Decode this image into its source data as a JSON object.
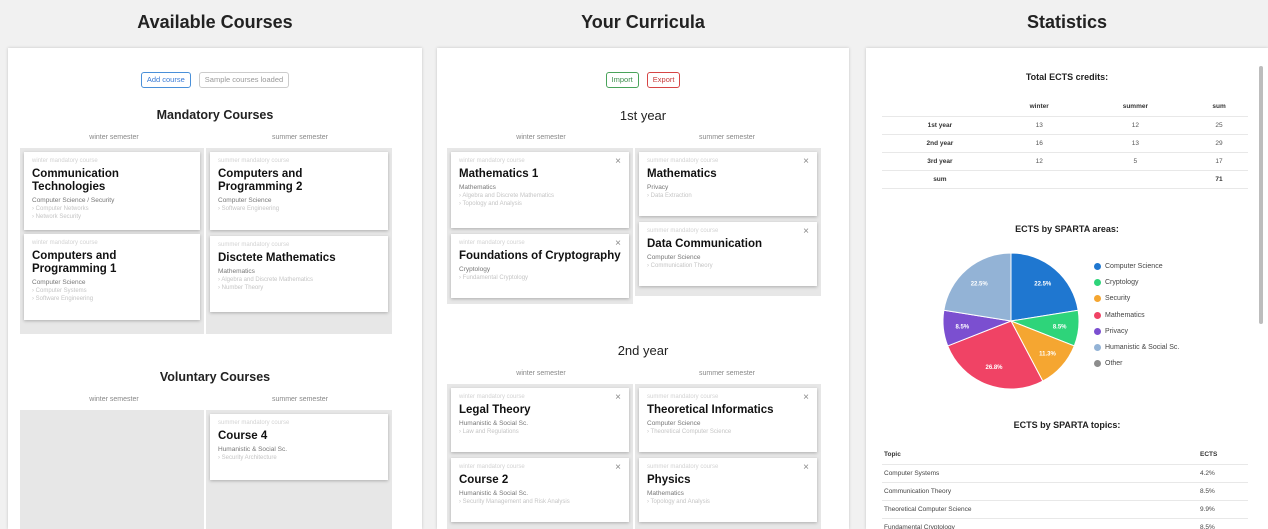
{
  "columns": {
    "available": "Available Courses",
    "curricula": "Your Curricula",
    "statistics": "Statistics"
  },
  "available": {
    "add_course": "Add course",
    "sample_loaded": "Sample courses loaded",
    "mandatory_title": "Mandatory Courses",
    "voluntary_title": "Voluntary Courses",
    "winter": "winter semester",
    "summer": "summer semester",
    "cards": [
      {
        "kind": "winter mandatory course",
        "name": "Communication Technologies",
        "area": "Computer Science / Security",
        "topics": [
          "› Computer Networks",
          "› Network Security"
        ]
      },
      {
        "kind": "winter mandatory course",
        "name": "Computers and Programming 1",
        "area": "Computer Science",
        "topics": [
          "› Computer Systems",
          "› Software Engineering"
        ]
      },
      {
        "kind": "summer mandatory course",
        "name": "Computers and Programming 2",
        "area": "Computer Science",
        "topics": [
          "› Software Engineering"
        ]
      },
      {
        "kind": "summer mandatory course",
        "name": "Disctete Mathematics",
        "area": "Mathematics",
        "topics": [
          "› Algebra and Discrete Mathematics",
          "› Number Theory"
        ]
      },
      {
        "kind": "summer mandatory course",
        "name": "Course 4",
        "area": "Humanistic & Social Sc.",
        "topics": [
          "› Security Architecture"
        ]
      }
    ]
  },
  "curricula": {
    "import": "Import",
    "export": "Export",
    "year1": "1st year",
    "year2": "2nd year",
    "winter": "winter semester",
    "summer": "summer semester",
    "close": "×",
    "cards": [
      {
        "kind": "winter mandatory course",
        "name": "Mathematics 1",
        "area": "Mathematics",
        "topics": [
          "› Algebra and Discrete Mathematics",
          "› Topology and Analysis"
        ]
      },
      {
        "kind": "winter mandatory course",
        "name": "Foundations of Cryptography",
        "area": "Cryptology",
        "topics": [
          "› Fundamental Cryptology"
        ]
      },
      {
        "kind": "summer mandatory course",
        "name": "Mathematics",
        "area": "Privacy",
        "topics": [
          "› Data Extraction"
        ]
      },
      {
        "kind": "summer mandatory course",
        "name": "Data Communication",
        "area": "Computer Science",
        "topics": [
          "› Communication Theory"
        ]
      },
      {
        "kind": "winter mandatory course",
        "name": "Legal Theory",
        "area": "Humanistic & Social Sc.",
        "topics": [
          "› Law and Regulations"
        ]
      },
      {
        "kind": "winter mandatory course",
        "name": "Course 2",
        "area": "Humanistic & Social Sc.",
        "topics": [
          "› Security Management and Risk Analysis"
        ]
      },
      {
        "kind": "summer mandatory course",
        "name": "Theoretical Informatics",
        "area": "Computer Science",
        "topics": [
          "› Theoretical Computer Science"
        ]
      },
      {
        "kind": "summer mandatory course",
        "name": "Physics",
        "area": "Mathematics",
        "topics": [
          "› Topology and Analysis"
        ]
      }
    ]
  },
  "statistics": {
    "total_title": "Total ECTS credits:",
    "total_headers": [
      "",
      "winter",
      "summer",
      "sum"
    ],
    "total_rows": [
      [
        "1st year",
        "13",
        "12",
        "25"
      ],
      [
        "2nd year",
        "16",
        "13",
        "29"
      ],
      [
        "3rd year",
        "12",
        "5",
        "17"
      ],
      [
        "sum",
        "",
        "",
        "71"
      ]
    ],
    "areas_title": "ECTS by SPARTA areas:",
    "topics_title": "ECTS by SPARTA topics:",
    "topics_headers": [
      "Topic",
      "ECTS"
    ],
    "topics_rows": [
      [
        "Computer Systems",
        "4.2%"
      ],
      [
        "Communication Theory",
        "8.5%"
      ],
      [
        "Theoretical Computer Science",
        "9.9%"
      ],
      [
        "Fundamental Cryptology",
        "8.5%"
      ]
    ]
  },
  "chart_data": {
    "type": "pie",
    "title": "ECTS by SPARTA areas:",
    "slices": [
      {
        "name": "Computer Science",
        "value": 22.5,
        "label": "22.5%",
        "color": "#1f77d0"
      },
      {
        "name": "Cryptology",
        "value": 8.5,
        "label": "8.5%",
        "color": "#2ed47a"
      },
      {
        "name": "Security",
        "value": 11.3,
        "label": "11.3%",
        "color": "#f5a631"
      },
      {
        "name": "Mathematics",
        "value": 26.8,
        "label": "26.8%",
        "color": "#f04365"
      },
      {
        "name": "Privacy",
        "value": 8.5,
        "label": "8.5%",
        "color": "#7b4fd0"
      },
      {
        "name": "Humanistic & Social Sc.",
        "value": 22.5,
        "label": "22.5%",
        "color": "#93b3d6"
      },
      {
        "name": "Other",
        "value": 0,
        "label": "",
        "color": "#8c8c8c"
      }
    ],
    "legend_position": "right"
  }
}
